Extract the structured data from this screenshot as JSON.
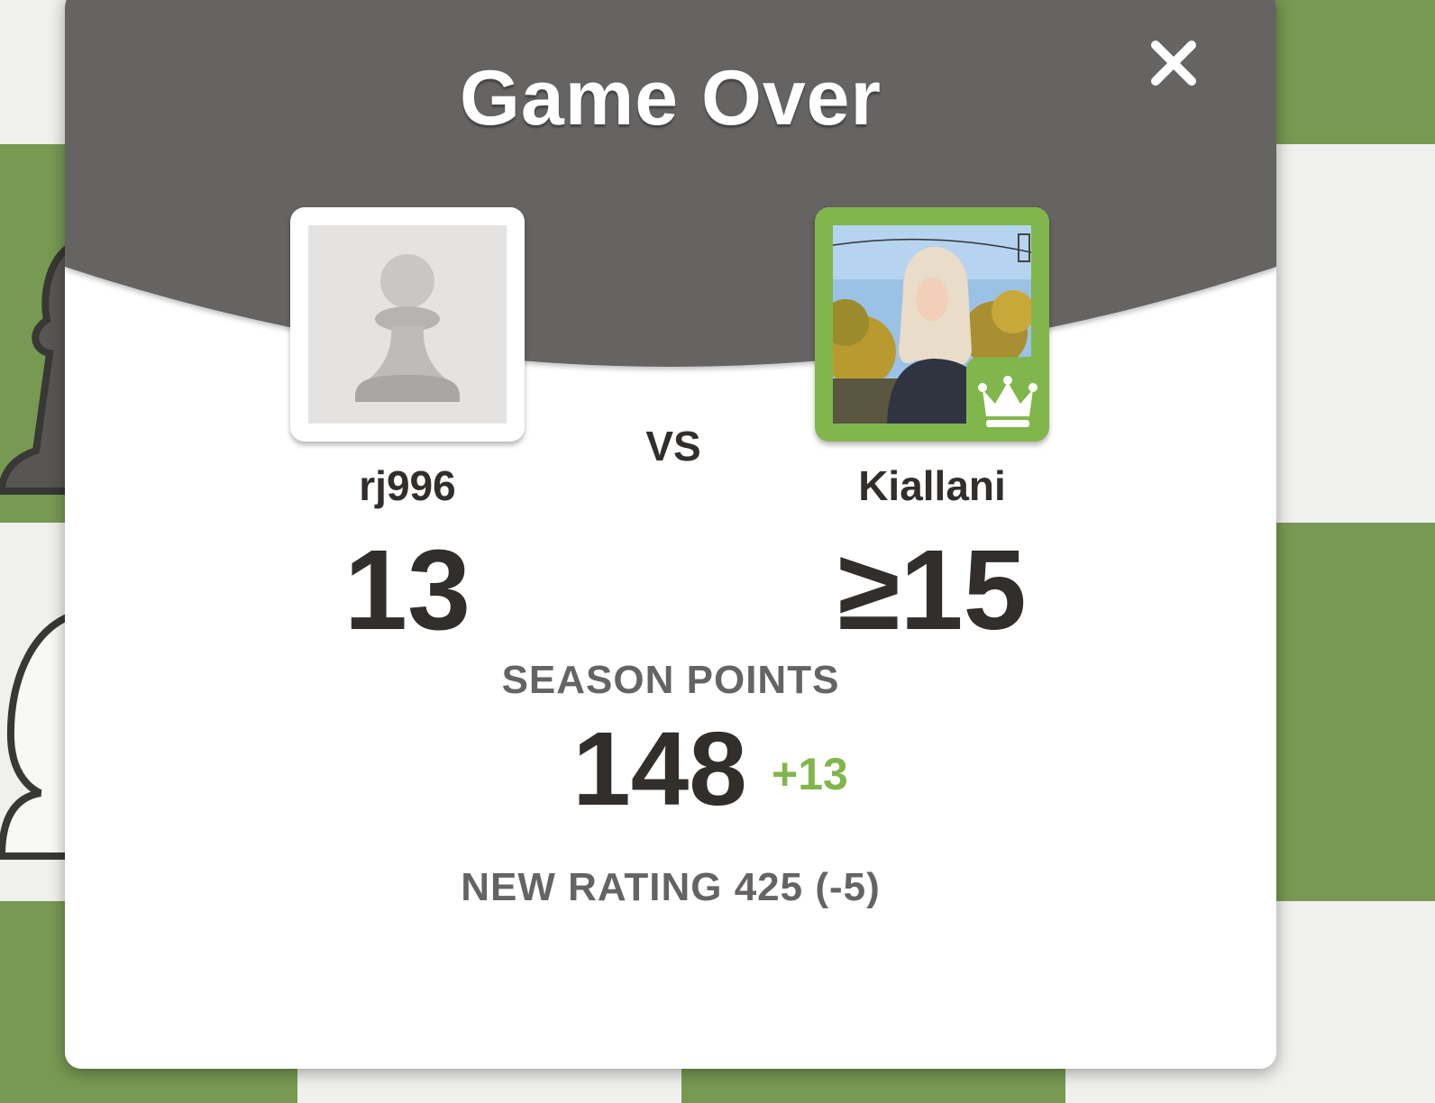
{
  "modal": {
    "title": "Game Over",
    "close_icon": "close-icon"
  },
  "players": {
    "left": {
      "username": "rj996",
      "score": "13",
      "avatar": "pawn-avatar-icon"
    },
    "right": {
      "username": "Kiallani",
      "score": "≥15",
      "avatar": "user-photo",
      "badge": "crown-icon"
    },
    "versus_label": "VS"
  },
  "season": {
    "label": "SEASON POINTS",
    "points": "148",
    "delta": "+13"
  },
  "rating": {
    "text": "NEW RATING 425 (-5)"
  },
  "colors": {
    "header": "#666463",
    "accent_green": "#81b64c",
    "board_dark": "#779952",
    "board_light": "#f0f0ee",
    "text_dark": "#312e2b"
  }
}
